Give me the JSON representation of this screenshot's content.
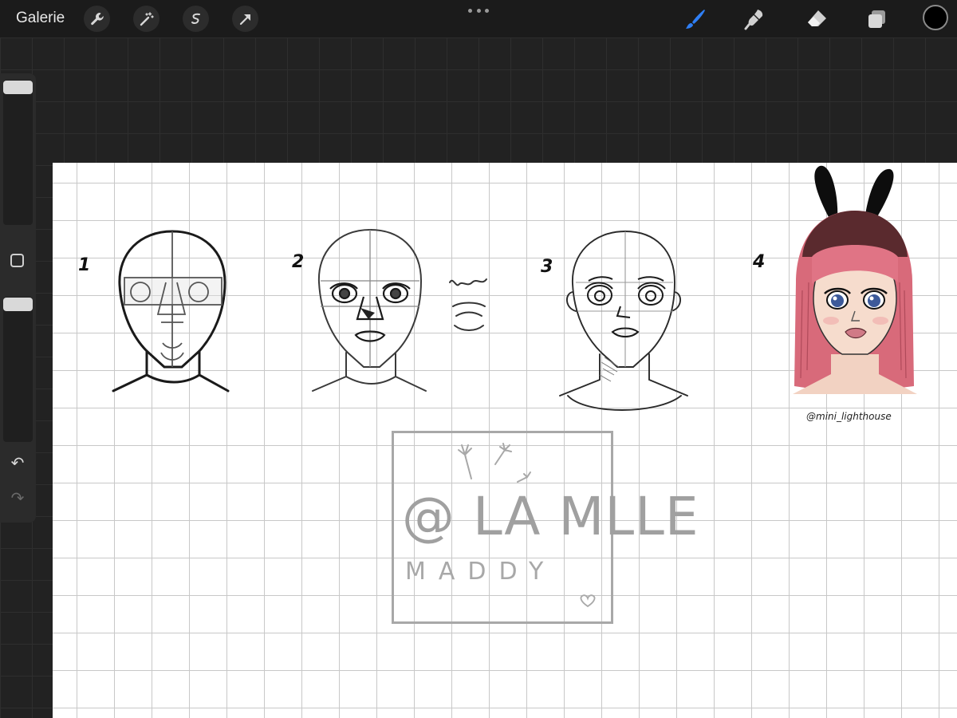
{
  "toolbar": {
    "gallery_label": "Galerie",
    "left_tools": [
      "wrench-icon",
      "magic-wand-icon",
      "selection-icon",
      "transform-arrow-icon"
    ],
    "right_tools": [
      "brush-icon",
      "smudge-icon",
      "eraser-icon",
      "layers-icon"
    ],
    "active_tool": "brush-icon",
    "active_color": "#000000",
    "accent_color": "#2f7ff5"
  },
  "sidebar": {
    "brush_size_level": 1.0,
    "opacity_level": 1.0,
    "undo_icon": "undo-icon",
    "redo_icon": "redo-icon"
  },
  "canvas": {
    "step_labels": [
      "1",
      "2",
      "3",
      "4"
    ],
    "signature": "@mini_lighthouse",
    "watermark_line1": "@ LA MLLE",
    "watermark_line2": "MADDY"
  }
}
